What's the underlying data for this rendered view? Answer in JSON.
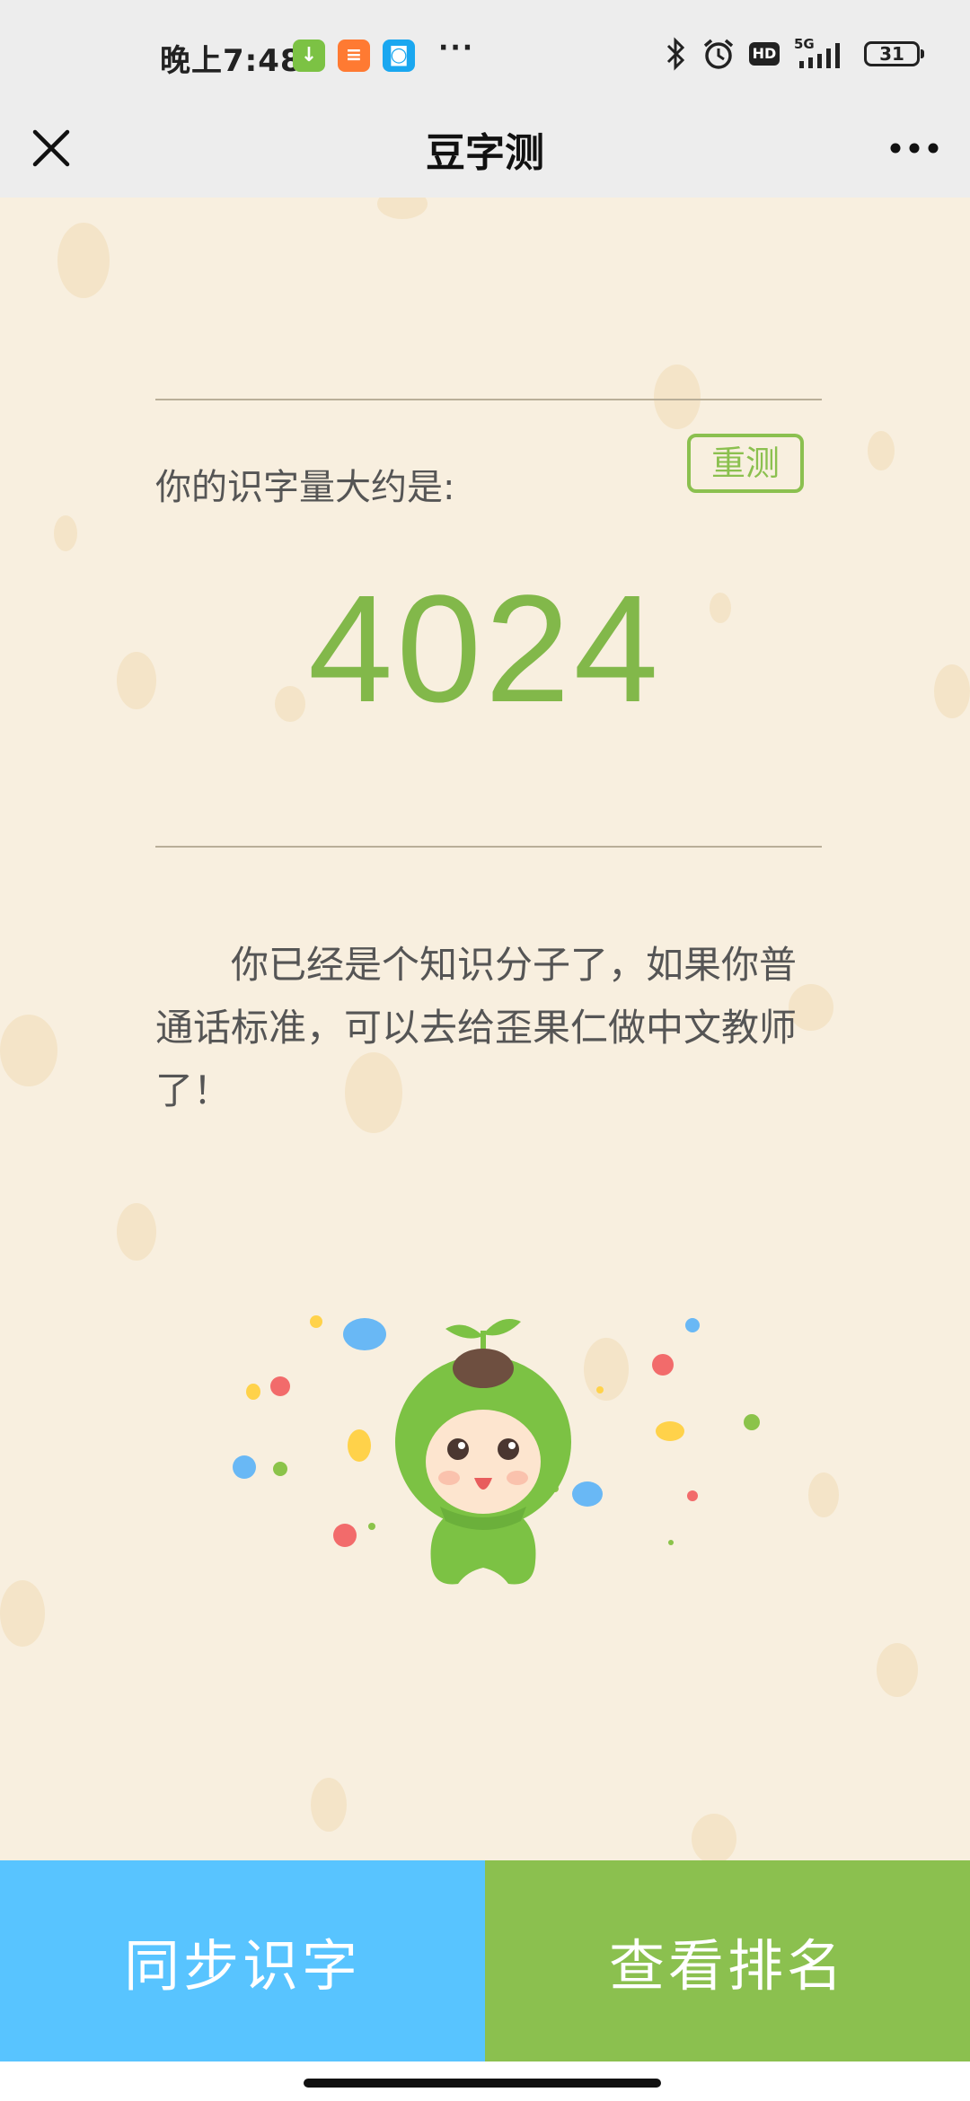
{
  "status_bar": {
    "time": "晚上7:48",
    "network": "5G",
    "battery": "31",
    "app_icons": [
      "download-app-icon",
      "shopping-app-icon",
      "browser-app-icon"
    ]
  },
  "header": {
    "title": "豆字测"
  },
  "result": {
    "label": "你的识字量大约是:",
    "retest_label": "重测",
    "score": "4024",
    "comment": "你已经是个知识分子了，如果你普通话标准，可以去给歪果仁做中文教师了！"
  },
  "actions": {
    "sync_label": "同步识字",
    "ranking_label": "查看排名"
  },
  "colors": {
    "accent_green": "#82b84a",
    "button_blue": "#58c4ff",
    "button_green": "#8bc04f",
    "background": "#f8efdf"
  }
}
